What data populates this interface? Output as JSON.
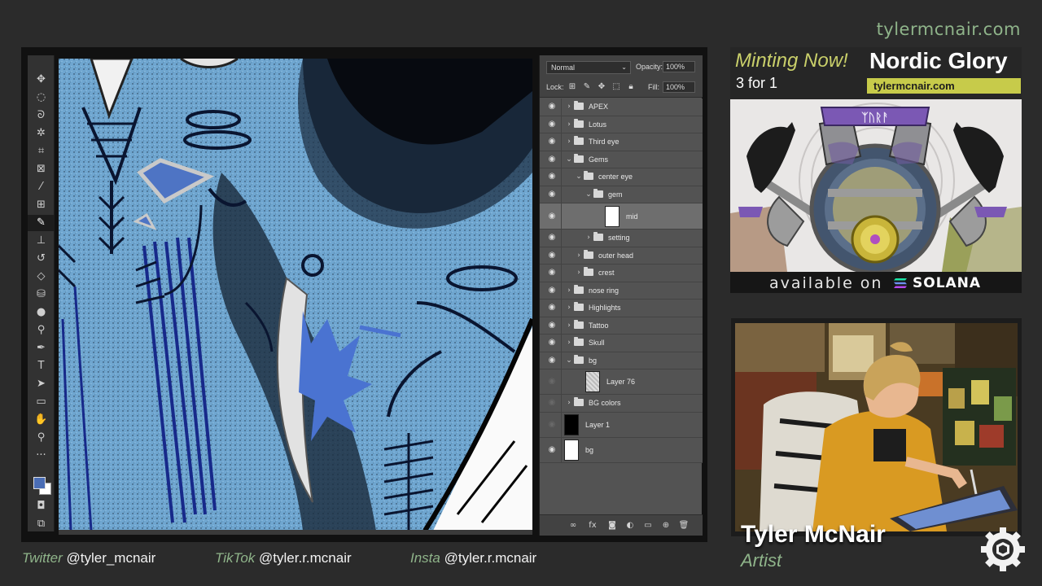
{
  "site": {
    "url": "tylermcnair.com"
  },
  "photoshop": {
    "blend_mode": "Normal",
    "opacity_label": "Opacity:",
    "opacity_value": "100%",
    "lock_label": "Lock:",
    "fill_label": "Fill:",
    "fill_value": "100%",
    "layers": [
      {
        "name": "APEX",
        "kind": "group",
        "expanded": false,
        "depth": 0,
        "visible": true
      },
      {
        "name": "Lotus",
        "kind": "group",
        "expanded": false,
        "depth": 0,
        "visible": true
      },
      {
        "name": "Third eye",
        "kind": "group",
        "expanded": false,
        "depth": 0,
        "visible": true
      },
      {
        "name": "Gems",
        "kind": "group",
        "expanded": true,
        "depth": 0,
        "visible": true
      },
      {
        "name": "center eye",
        "kind": "group",
        "expanded": true,
        "depth": 1,
        "visible": true
      },
      {
        "name": "gem",
        "kind": "group",
        "expanded": true,
        "depth": 2,
        "visible": true
      },
      {
        "name": "mid",
        "kind": "layer",
        "thumb": "white",
        "depth": 3,
        "visible": true,
        "selected": true
      },
      {
        "name": "setting",
        "kind": "group",
        "expanded": false,
        "depth": 2,
        "visible": true
      },
      {
        "name": "outer head",
        "kind": "group",
        "expanded": false,
        "depth": 1,
        "visible": true
      },
      {
        "name": "crest",
        "kind": "group",
        "expanded": false,
        "depth": 1,
        "visible": true
      },
      {
        "name": "nose ring",
        "kind": "group",
        "expanded": false,
        "depth": 0,
        "visible": true
      },
      {
        "name": "Highlights",
        "kind": "group",
        "expanded": false,
        "depth": 0,
        "visible": true
      },
      {
        "name": "Tattoo",
        "kind": "group",
        "expanded": false,
        "depth": 0,
        "visible": true
      },
      {
        "name": "Skull",
        "kind": "group",
        "expanded": false,
        "depth": 0,
        "visible": true
      },
      {
        "name": "bg",
        "kind": "group",
        "expanded": true,
        "depth": 0,
        "visible": true
      },
      {
        "name": "Layer 76",
        "kind": "layer",
        "thumb": "texture",
        "depth": 1,
        "visible": false
      },
      {
        "name": "BG colors",
        "kind": "group",
        "expanded": false,
        "depth": 0,
        "visible": false
      },
      {
        "name": "Layer 1",
        "kind": "layer",
        "thumb": "black",
        "depth": 0,
        "visible": false
      },
      {
        "name": "bg",
        "kind": "layer",
        "thumb": "white",
        "depth": 0,
        "visible": true
      }
    ],
    "colors": {
      "foreground": "#4a6db5",
      "background": "#ffffff"
    }
  },
  "promo": {
    "minting": "Minting Now!",
    "title": "Nordic Glory",
    "offer": "3 for 1",
    "url": "tylermcnair.com",
    "banner_runes": "ᛉᚢᚱᚨ",
    "available": "available on",
    "platform": "SOLANA"
  },
  "streamer": {
    "name": "Tyler McNair",
    "role": "Artist"
  },
  "socials": [
    {
      "platform": "Twitter",
      "handle": "@tyler_mcnair"
    },
    {
      "platform": "TikTok",
      "handle": "@tyler.r.mcnair"
    },
    {
      "platform": "Insta",
      "handle": "@tyler.r.mcnair"
    }
  ]
}
